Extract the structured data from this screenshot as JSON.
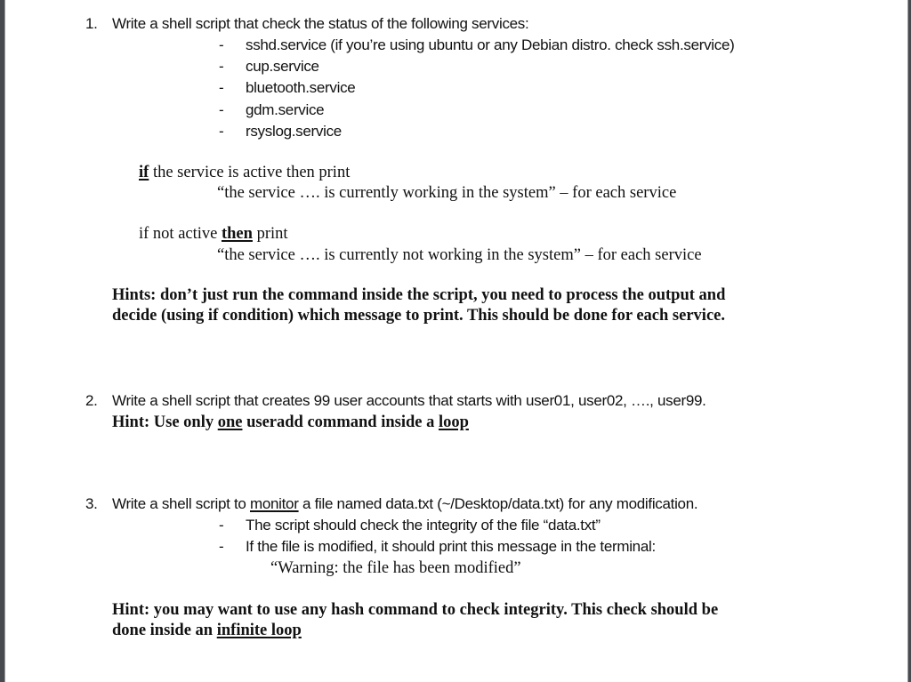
{
  "question1": {
    "number": "1.",
    "title": "Write a shell script that check the status of the following services:",
    "services": [
      "sshd.service (if you’re using ubuntu or any Debian distro. check ssh.service)",
      "cup.service",
      "bluetooth.service",
      "gdm.service",
      "rsyslog.service"
    ],
    "bullet": "-",
    "if_active": {
      "keyword": "if",
      "rest": " the service is active then print",
      "message": "“the service …. is currently working in the system” – for each service"
    },
    "if_not_active": {
      "prefix": "if not active ",
      "keyword": "then",
      "suffix": " print",
      "message": "“the service …. is currently not working in the system” – for each service"
    },
    "hint_line1": "Hints: don’t just run the command inside the script, you need to process the output and",
    "hint_line2": "decide (using if condition) which message to print. This should be done for each service."
  },
  "question2": {
    "number": "2.",
    "title": "Write a shell script that creates 99 user accounts that starts with user01, user02, …., user99.",
    "hint_prefix": "Hint: Use only ",
    "hint_u1": "one",
    "hint_mid": " useradd command inside a ",
    "hint_u2": "loop"
  },
  "question3": {
    "number": "3.",
    "title_prefix": "Write a shell script to ",
    "title_u": "monitor",
    "title_suffix": " a file named data.txt (~/Desktop/data.txt) for any modification.",
    "bullets": [
      "The script should check the integrity of the file “data.txt”",
      "If the file is modified, it should print this message in the terminal:"
    ],
    "bullet": "-",
    "warning": "“Warning: the file has been modified”",
    "hint_line1": "Hint: you may want to use any hash command to check integrity. This check should be",
    "hint_line2_prefix": "done inside an ",
    "hint_line2_u": "infinite loop"
  }
}
